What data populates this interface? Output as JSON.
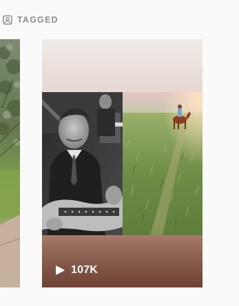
{
  "header": {
    "tab_icon": "tagged-person-icon",
    "tab_label": "TAGGED"
  },
  "tiles": [
    {
      "kind": "partial-video-thumbnail",
      "description_icon": "landscape-trail-thumbnail"
    },
    {
      "kind": "video-thumbnail",
      "play_icon": "play-icon",
      "views": "107K"
    }
  ],
  "colors": {
    "page_background": "#fafafa",
    "tab_text": "#8e8e8e",
    "overlay_text": "#ffffff"
  }
}
